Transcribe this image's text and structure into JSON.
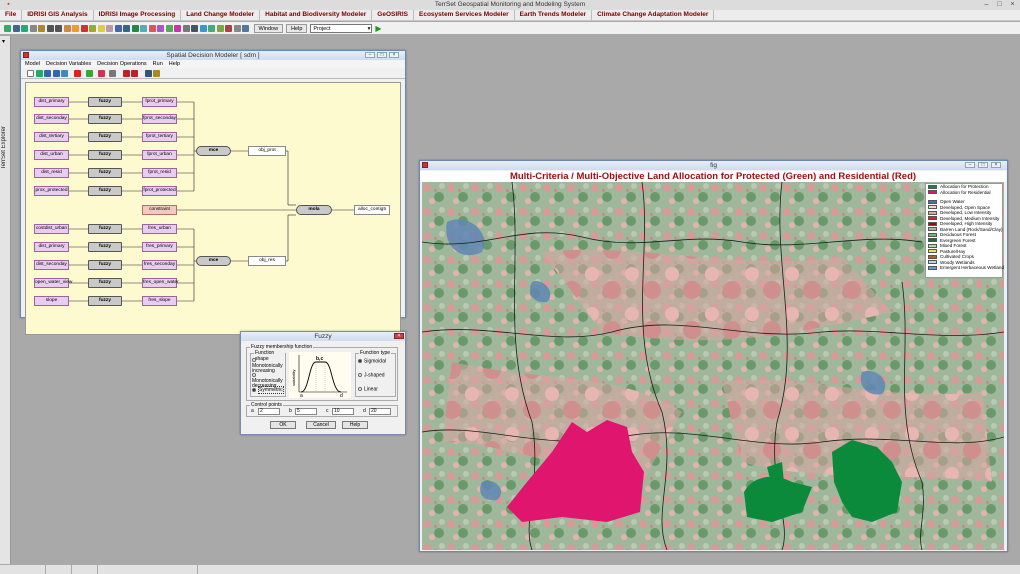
{
  "app": {
    "title": "TerrSet Geospatial Monitoring and Modeling System"
  },
  "menubar": {
    "items": [
      "File",
      "IDRISI GIS Analysis",
      "IDRISI Image Processing",
      "Land Change Modeler",
      "Habitat and Biodiversity Modeler",
      "GeOSIRIS",
      "Ecosystem Services Modeler",
      "Earth Trends Modeler",
      "Climate Change Adaptation Modeler"
    ]
  },
  "toolbar": {
    "window_label": "Window",
    "help_label": "Help",
    "project_value": "Project"
  },
  "explorer": {
    "label": "TerrSet Explorer"
  },
  "sdm": {
    "title": "Spatial Decision Modeler  [ sdm ]",
    "menu": [
      "Model",
      "Decision Variables",
      "Decision Operations",
      "Run",
      "Help"
    ],
    "nodes": {
      "inputs": [
        "dist_primary",
        "dist_seconday",
        "dist_tertiary",
        "dist_urban",
        "dist_resid",
        "prox_protected",
        "costdist_urban",
        "dist_primary",
        "dist_seconday",
        "open_water_view",
        "slope"
      ],
      "fuzzy": "fuzzy",
      "results": [
        "fprot_primary",
        "fprot_seconday",
        "fprot_tertiary",
        "fprot_urban",
        "fprot_resid",
        "fprot_protected",
        "fres_urban",
        "fres_primary",
        "fres_seconday",
        "fres_open_water",
        "fres_slope"
      ],
      "constraint": "constraint",
      "mce": "mce",
      "mola": "mola",
      "obj_prot": "obj_prot",
      "obj_res": "obj_res",
      "alloc": "alloc_contig5"
    }
  },
  "fuzzy": {
    "title": "Fuzzy",
    "group_label": "Fuzzy membership function",
    "shape": {
      "label": "Function shape",
      "options": [
        "Monotonically increasing",
        "Monotonically decreasing",
        "Symmetric"
      ],
      "selected": 2
    },
    "type": {
      "label": "Function type",
      "options": [
        "Sigmoidal",
        "J-shaped",
        "Linear"
      ],
      "selected": 0
    },
    "graph": {
      "ylabel": "suitability",
      "labels": [
        "a",
        "b,c",
        "d"
      ]
    },
    "control": {
      "label": "Control points",
      "a": "2",
      "b": "5",
      "c": "10",
      "d": "20",
      "a_label": "a",
      "b_label": "b",
      "c_label": "c",
      "d_label": "d"
    },
    "buttons": {
      "ok": "OK",
      "cancel": "Cancel",
      "help": "Help"
    }
  },
  "map": {
    "window_title": "fig",
    "title": "Multi-Criteria / Multi-Objective Land Allocation for Protected (Green) and Residential (Red)",
    "legend_top": [
      {
        "label": "Allocation for Protection",
        "color": "#0c8a3c"
      },
      {
        "label": "Allocation for Residential",
        "color": "#e0156e"
      }
    ],
    "legend": [
      {
        "label": "Open Water",
        "color": "#4a6fc0"
      },
      {
        "label": "Developed, Open Space",
        "color": "#f3d9d6"
      },
      {
        "label": "Developed, Low Intensity",
        "color": "#e8a4a0"
      },
      {
        "label": "Developed, Medium Intensity",
        "color": "#e02020"
      },
      {
        "label": "Developed, High Intensity",
        "color": "#9a0c0c"
      },
      {
        "label": "Barren Land (Rock/Sand/Clay)",
        "color": "#b4aea4"
      },
      {
        "label": "Deciduous Forest",
        "color": "#6cba6a"
      },
      {
        "label": "Evergreen Forest",
        "color": "#1f6b32"
      },
      {
        "label": "Mixed Forest",
        "color": "#b8d9a8"
      },
      {
        "label": "Pasture/Hay",
        "color": "#e8e06a"
      },
      {
        "label": "Cultivated Crops",
        "color": "#a8642a"
      },
      {
        "label": "Woody Wetlands",
        "color": "#b8d6e8"
      },
      {
        "label": "Emergent Herbaceous Wetlands",
        "color": "#6a9cc8"
      }
    ]
  }
}
